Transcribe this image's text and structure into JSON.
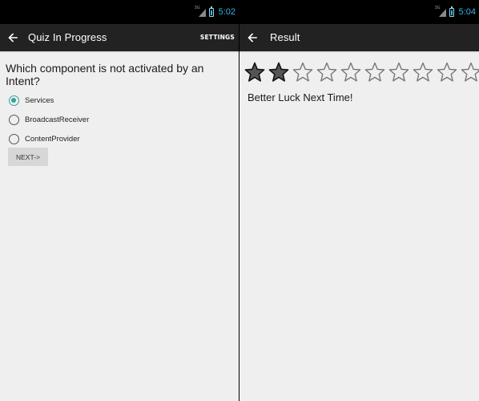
{
  "left_screen": {
    "status_bar": {
      "network": "3G",
      "clock": "5:02"
    },
    "action_bar": {
      "title": "Quiz In Progress",
      "action": "SETTINGS"
    },
    "question": "Which component is not activated by an Intent?",
    "options": [
      {
        "label": "Services",
        "selected": true
      },
      {
        "label": "BroadcastReceiver",
        "selected": false
      },
      {
        "label": "ContentProvider",
        "selected": false
      }
    ],
    "next_button": "NEXT->"
  },
  "right_screen": {
    "status_bar": {
      "network": "3G",
      "clock": "5:04"
    },
    "action_bar": {
      "title": "Result"
    },
    "rating": {
      "value": 2,
      "max": 10
    },
    "result_message": "Better Luck Next Time!"
  },
  "icons": {
    "back": "arrow-left-icon",
    "signal": "signal-icon",
    "battery": "battery-icon",
    "star_filled": "star-filled-icon",
    "star_empty": "star-outline-icon"
  },
  "colors": {
    "status_clock": "#33b5e5",
    "action_bar": "#222222",
    "screen_background": "#efefef",
    "radio_accent": "#2fa39b",
    "star_filled": "#555555"
  }
}
